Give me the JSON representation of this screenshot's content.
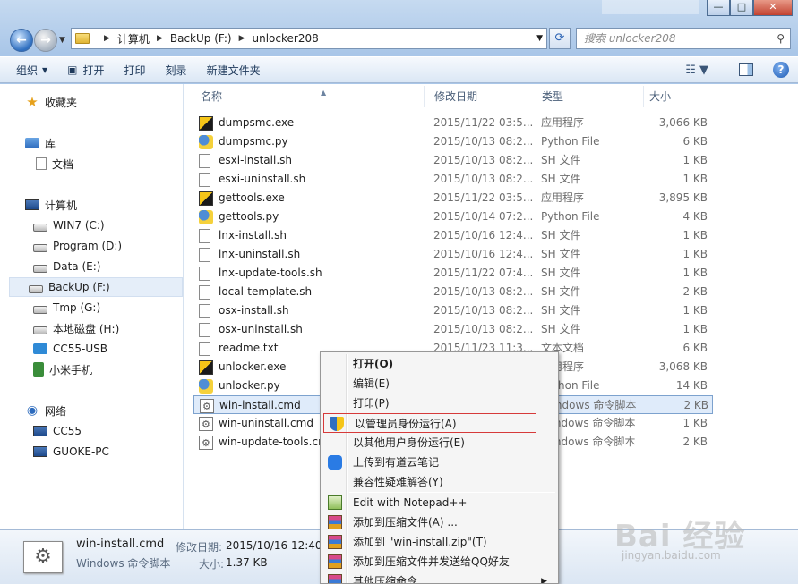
{
  "window": {
    "minimize": "—",
    "maximize": "□",
    "close": "✕"
  },
  "address": {
    "crumbs": [
      "计算机",
      "BackUp (F:)",
      "unlocker208"
    ],
    "search_placeholder": "搜索 unlocker208"
  },
  "toolbar": {
    "organize": "组织",
    "open": "打开",
    "print": "打印",
    "burn": "刻录",
    "new_folder": "新建文件夹"
  },
  "nav": {
    "favorites": "收藏夹",
    "libraries": "库",
    "documents": "文档",
    "computer": "计算机",
    "drives": [
      "WIN7 (C:)",
      "Program (D:)",
      "Data (E:)",
      "BackUp (F:)",
      "Tmp (G:)",
      "本地磁盘 (H:)",
      "CC55-USB",
      "小米手机"
    ],
    "network": "网络",
    "network_items": [
      "CC55",
      "GUOKE-PC"
    ]
  },
  "columns": {
    "name": "名称",
    "date": "修改日期",
    "type": "类型",
    "size": "大小"
  },
  "files": [
    {
      "name": "dumpsmc.exe",
      "date": "2015/11/22 03:5...",
      "type": "应用程序",
      "size": "3,066 KB",
      "icon": "exe"
    },
    {
      "name": "dumpsmc.py",
      "date": "2015/10/13 08:2...",
      "type": "Python File",
      "size": "6 KB",
      "icon": "py"
    },
    {
      "name": "esxi-install.sh",
      "date": "2015/10/13 08:2...",
      "type": "SH 文件",
      "size": "1 KB",
      "icon": "sh"
    },
    {
      "name": "esxi-uninstall.sh",
      "date": "2015/10/13 08:2...",
      "type": "SH 文件",
      "size": "1 KB",
      "icon": "sh"
    },
    {
      "name": "gettools.exe",
      "date": "2015/11/22 03:5...",
      "type": "应用程序",
      "size": "3,895 KB",
      "icon": "exe"
    },
    {
      "name": "gettools.py",
      "date": "2015/10/14 07:2...",
      "type": "Python File",
      "size": "4 KB",
      "icon": "py"
    },
    {
      "name": "lnx-install.sh",
      "date": "2015/10/16 12:4...",
      "type": "SH 文件",
      "size": "1 KB",
      "icon": "sh"
    },
    {
      "name": "lnx-uninstall.sh",
      "date": "2015/10/16 12:4...",
      "type": "SH 文件",
      "size": "1 KB",
      "icon": "sh"
    },
    {
      "name": "lnx-update-tools.sh",
      "date": "2015/11/22 07:4...",
      "type": "SH 文件",
      "size": "1 KB",
      "icon": "sh"
    },
    {
      "name": "local-template.sh",
      "date": "2015/10/13 08:2...",
      "type": "SH 文件",
      "size": "2 KB",
      "icon": "sh"
    },
    {
      "name": "osx-install.sh",
      "date": "2015/10/13 08:2...",
      "type": "SH 文件",
      "size": "1 KB",
      "icon": "sh"
    },
    {
      "name": "osx-uninstall.sh",
      "date": "2015/10/13 08:2...",
      "type": "SH 文件",
      "size": "1 KB",
      "icon": "sh"
    },
    {
      "name": "readme.txt",
      "date": "2015/11/23 11:3...",
      "type": "文本文档",
      "size": "6 KB",
      "icon": "txt"
    },
    {
      "name": "unlocker.exe",
      "date": "",
      "type": "应用程序",
      "size": "3,068 KB",
      "icon": "exe"
    },
    {
      "name": "unlocker.py",
      "date": "",
      "type": "Python File",
      "size": "14 KB",
      "icon": "py"
    },
    {
      "name": "win-install.cmd",
      "date": "",
      "type": "Windows 命令脚本",
      "size": "2 KB",
      "icon": "cmd",
      "selected": true
    },
    {
      "name": "win-uninstall.cmd",
      "date": "",
      "type": "Windows 命令脚本",
      "size": "1 KB",
      "icon": "cmd"
    },
    {
      "name": "win-update-tools.cmd",
      "date": "",
      "type": "Windows 命令脚本",
      "size": "2 KB",
      "icon": "cmd"
    }
  ],
  "details": {
    "name": "win-install.cmd",
    "type": "Windows 命令脚本",
    "modified_label": "修改日期:",
    "modified_value": "2015/10/16 12:40",
    "size_label": "大小:",
    "size_value": "1.37 KB"
  },
  "context_menu": [
    {
      "label": "打开(O)",
      "bold": true
    },
    {
      "label": "编辑(E)"
    },
    {
      "label": "打印(P)"
    },
    {
      "label": "以管理员身份运行(A)",
      "icon": "shield",
      "highlight": true
    },
    {
      "label": "以其他用户身份运行(E)"
    },
    {
      "label": "上传到有道云笔记",
      "icon": "cloud"
    },
    {
      "label": "兼容性疑难解答(Y)"
    },
    {
      "label": "Edit with Notepad++",
      "icon": "notepad"
    },
    {
      "label": "添加到压缩文件(A) ...",
      "icon": "rar"
    },
    {
      "label": "添加到 \"win-install.zip\"(T)",
      "icon": "rar"
    },
    {
      "label": "添加到压缩文件并发送给QQ好友",
      "icon": "rar"
    },
    {
      "label": "其他压缩命令",
      "icon": "rar",
      "submenu": true
    }
  ],
  "watermark": {
    "brand": "Bai 经验",
    "url": "jingyan.baidu.com"
  },
  "colors": {
    "selection": "#dfebfa",
    "highlight_border": "#d63a3a",
    "toolbar_text": "#1e395b"
  }
}
